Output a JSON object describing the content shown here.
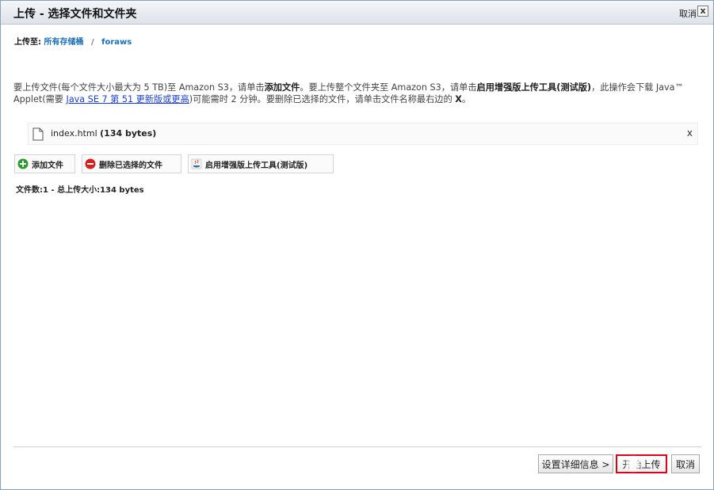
{
  "dialog": {
    "title": "上传 - 选择文件和文件夹",
    "close_label": "取消",
    "close_x": "x"
  },
  "breadcrumb": {
    "label": "上传至:",
    "items": [
      "所有存储桶",
      "foraws"
    ],
    "separator": "/"
  },
  "instructions": {
    "part1": "要上传文件(每个文件大小最大为 5 TB)至 Amazon S3，请单击",
    "add_files_bold": "添加文件",
    "part2": "。要上传整个文件夹至 Amazon S3，请单击",
    "enhanced_bold": "启用增强版上传工具(测试版)",
    "part3": "，此操作会下载 Java™ Applet(需要 ",
    "java_link": "Java SE 7 第 51 更新版或更高",
    "part4": ")可能需时 2 分钟。要删除已选择的文件，请单击文件名称最右边的 ",
    "x_bold": "X",
    "part5": "。"
  },
  "file_list": [
    {
      "name": "index.html",
      "size": "(134 bytes)",
      "remove": "x"
    }
  ],
  "actions": {
    "add_files": "添加文件",
    "remove_selected": "删除已选择的文件",
    "enhanced_uploader": "启用增强版上传工具(测试版)"
  },
  "summary": "文件数:1 - 总上传大小:134 bytes",
  "footer": {
    "details_button": "设置详细信息 >",
    "upload_button": "开始上传",
    "cancel_button": "取消"
  },
  "colors": {
    "link": "#1a6fb5",
    "java_link": "#1a3fd0",
    "upload_highlight": "#e0001a"
  },
  "icons": [
    "file-icon",
    "plus-icon",
    "minus-icon",
    "java-icon",
    "close-icon"
  ]
}
